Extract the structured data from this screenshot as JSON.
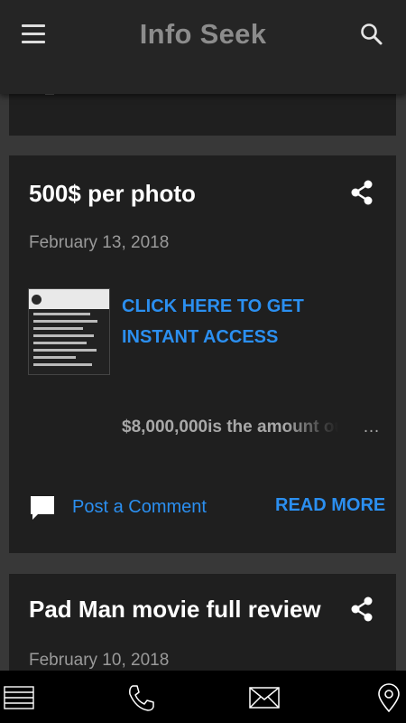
{
  "header": {
    "title": "Info Seek",
    "menu_icon": "hamburger-icon",
    "search_icon": "search-icon"
  },
  "posts": [
    {
      "title": "500$ per photo",
      "date": "February 13, 2018",
      "cta": "CLICK HERE TO GET INSTANT ACCESS",
      "snippet": "$8,000,000is the amount ou",
      "ellipsis": "…",
      "comment_label": "Post a Comment",
      "read_more": "READ MORE",
      "share_icon": "share-icon",
      "comment_icon": "comment-icon"
    },
    {
      "title": "Pad Man movie full review",
      "date": "February 10, 2018",
      "share_icon": "share-icon"
    }
  ],
  "bottom_nav": [
    {
      "icon": "menu-lines-icon"
    },
    {
      "icon": "phone-icon"
    },
    {
      "icon": "mail-icon"
    },
    {
      "icon": "location-pin-icon"
    }
  ],
  "colors": {
    "accent": "#2b8ff0",
    "card_bg": "#1f1f1f",
    "page_bg": "#383838",
    "topbar_bg": "#252525",
    "bottombar_bg": "#000000"
  }
}
